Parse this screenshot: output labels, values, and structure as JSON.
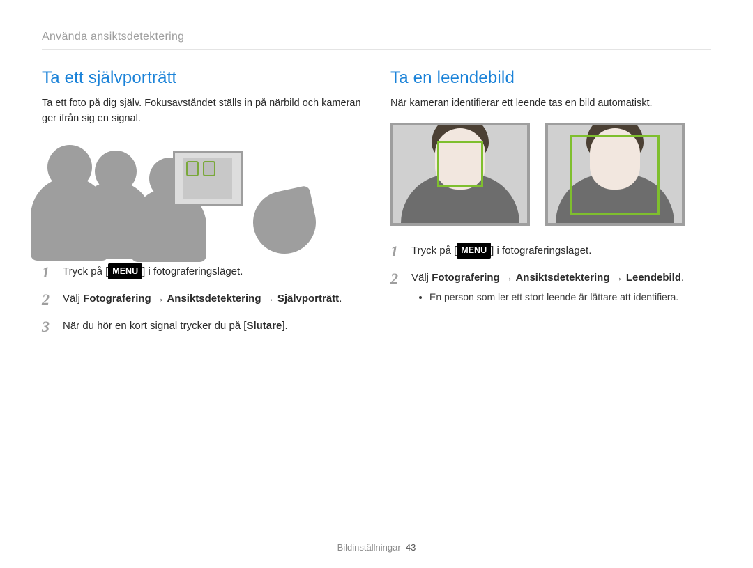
{
  "breadcrumb": "Använda ansiktsdetektering",
  "left": {
    "title": "Ta ett självporträtt",
    "intro": "Ta ett foto på dig själv. Fokusavståndet ställs in på närbild och kameran ger ifrån sig en signal.",
    "menu_chip": "MENU",
    "steps": {
      "s1_pre": "Tryck på [",
      "s1_post": "] i fotograferingsläget.",
      "s2_pre": "Välj ",
      "s2_bold": "Fotografering → Ansiktsdetektering → Självporträtt",
      "s2_post": ".",
      "s3_pre": "När du hör en kort signal trycker du på [",
      "s3_bold": "Slutare",
      "s3_post": "]."
    }
  },
  "right": {
    "title": "Ta en leendebild",
    "intro": "När kameran identifierar ett leende tas en bild automatiskt.",
    "menu_chip": "MENU",
    "steps": {
      "s1_pre": "Tryck på [",
      "s1_post": "] i fotograferingsläget.",
      "s2_pre": "Välj ",
      "s2_bold": "Fotografering → Ansiktsdetektering → Leendebild",
      "s2_post": ".",
      "note": "En person som ler ett stort leende är lättare att identifiera."
    }
  },
  "footer": {
    "section": "Bildinställningar",
    "page": "43"
  }
}
